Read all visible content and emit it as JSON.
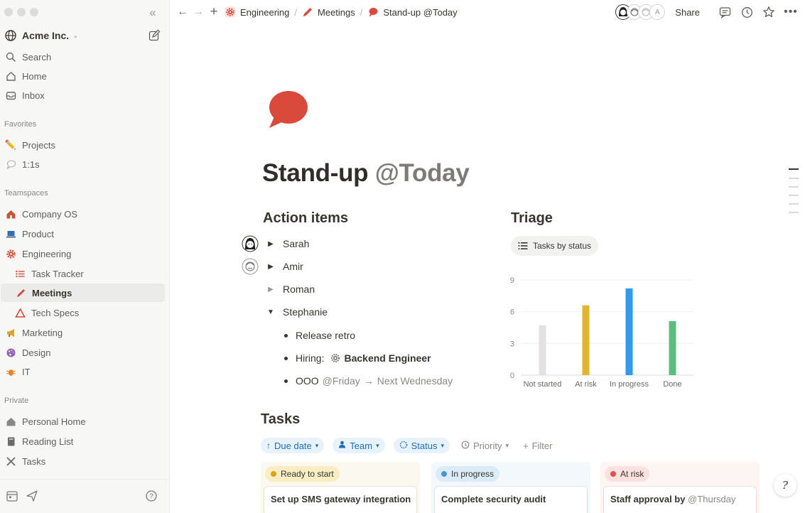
{
  "sidebar": {
    "workspace": "Acme Inc.",
    "search": "Search",
    "home": "Home",
    "inbox": "Inbox",
    "favorites_label": "Favorites",
    "favorites": [
      {
        "label": "Projects",
        "icon": "pencil-icon"
      },
      {
        "label": "1:1s",
        "icon": "speech-bubble-icon"
      }
    ],
    "teamspaces_label": "Teamspaces",
    "teamspaces": [
      {
        "label": "Company OS",
        "icon": "house-icon"
      },
      {
        "label": "Product",
        "icon": "laptop-icon"
      },
      {
        "label": "Engineering",
        "icon": "gear-icon"
      },
      {
        "label": "Task Tracker",
        "icon": "list-icon"
      },
      {
        "label": "Meetings",
        "icon": "pencil-icon"
      },
      {
        "label": "Tech Specs",
        "icon": "triangle-icon"
      },
      {
        "label": "Marketing",
        "icon": "megaphone-icon"
      },
      {
        "label": "Design",
        "icon": "palette-icon"
      },
      {
        "label": "IT",
        "icon": "bug-icon"
      }
    ],
    "private_label": "Private",
    "private": [
      {
        "label": "Personal Home",
        "icon": "house-icon"
      },
      {
        "label": "Reading List",
        "icon": "book-icon"
      },
      {
        "label": "Tasks",
        "icon": "tools-icon"
      }
    ]
  },
  "topbar": {
    "breadcrumbs": [
      "Engineering",
      "Meetings",
      "Stand-up @Today"
    ],
    "avatar_letter": "A",
    "share": "Share"
  },
  "page": {
    "title": "Stand-up",
    "title_mention": "@Today",
    "action_items_heading": "Action items",
    "people": [
      "Sarah",
      "Amir",
      "Roman",
      "Stephanie"
    ],
    "bullets": {
      "retro": "Release retro",
      "hiring_label": "Hiring:",
      "hiring_link": "Backend Engineer",
      "ooo": "OOO",
      "ooo_mention": "@Friday",
      "ooo_arrow": "→",
      "ooo_next": "Next Wednesday"
    },
    "triage_heading": "Triage",
    "triage_view": "Tasks by status",
    "tasks_heading": "Tasks"
  },
  "chart_data": {
    "type": "bar",
    "categories": [
      "Not started",
      "At risk",
      "In progress",
      "Done"
    ],
    "values": [
      4.7,
      6.6,
      8.2,
      5.1
    ],
    "colors": [
      "#e3e2e0",
      "#e3b42f",
      "#2e9bf0",
      "#5cbd7c"
    ],
    "y_ticks": [
      0,
      3,
      6,
      9
    ],
    "ylim": [
      0,
      9
    ],
    "grid": true
  },
  "filters": {
    "due_date": "Due date",
    "team": "Team",
    "status": "Status",
    "priority": "Priority",
    "filter": "Filter"
  },
  "board": [
    {
      "status": "Ready to start",
      "card": "Set up SMS gateway integration",
      "bg": "#fbf8ef",
      "pill": "#f9edc4",
      "dot": "#d9a319"
    },
    {
      "status": "In progress",
      "card": "Complete security audit",
      "bg": "#f3f8fc",
      "pill": "#dcecf7",
      "dot": "#4a93cf"
    },
    {
      "status": "At risk",
      "card": "Staff approval by",
      "card_mention": "@Thursday",
      "bg": "#fdf5f4",
      "pill": "#fbe1df",
      "dot": "#e2504a"
    }
  ]
}
